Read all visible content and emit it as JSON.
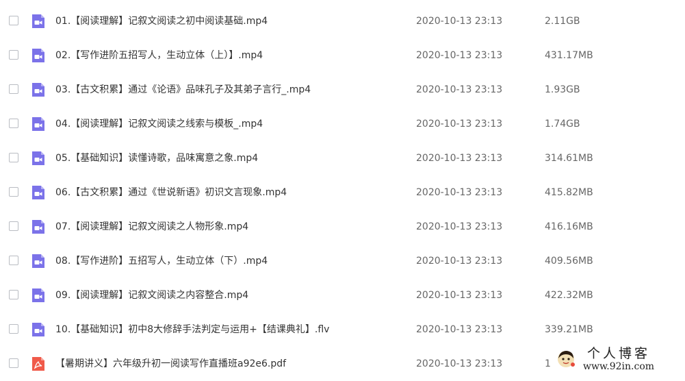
{
  "files": [
    {
      "name": "01.【阅读理解】记叙文阅读之初中阅读基础.mp4",
      "date": "2020-10-13 23:13",
      "size": "2.11GB",
      "type": "video"
    },
    {
      "name": "02.【写作进阶五招写人，生动立体（上）】.mp4",
      "date": "2020-10-13 23:13",
      "size": "431.17MB",
      "type": "video"
    },
    {
      "name": "03.【古文积累】通过《论语》品味孔子及其弟子言行_.mp4",
      "date": "2020-10-13 23:13",
      "size": "1.93GB",
      "type": "video"
    },
    {
      "name": "04.【阅读理解】记叙文阅读之线索与模板_.mp4",
      "date": "2020-10-13 23:13",
      "size": "1.74GB",
      "type": "video"
    },
    {
      "name": "05.【基础知识】读懂诗歌，品味寓意之象.mp4",
      "date": "2020-10-13 23:13",
      "size": "314.61MB",
      "type": "video"
    },
    {
      "name": "06.【古文积累】通过《世说新语》初识文言现象.mp4",
      "date": "2020-10-13 23:13",
      "size": "415.82MB",
      "type": "video"
    },
    {
      "name": "07.【阅读理解】记叙文阅读之人物形象.mp4",
      "date": "2020-10-13 23:13",
      "size": "416.16MB",
      "type": "video"
    },
    {
      "name": "08.【写作进阶】五招写人，生动立体（下）.mp4",
      "date": "2020-10-13 23:13",
      "size": "409.56MB",
      "type": "video"
    },
    {
      "name": "09.【阅读理解】记叙文阅读之内容整合.mp4",
      "date": "2020-10-13 23:13",
      "size": "422.32MB",
      "type": "video"
    },
    {
      "name": "10.【基础知识】初中8大修辞手法判定与运用+【结课典礼】.flv",
      "date": "2020-10-13 23:13",
      "size": "339.21MB",
      "type": "video"
    },
    {
      "name": "【暑期讲义】六年级升初一阅读写作直播班a92e6.pdf",
      "date": "2020-10-13 23:13",
      "size": "1",
      "type": "pdf"
    }
  ],
  "icons": {
    "video": "video-file-icon",
    "pdf": "pdf-file-icon"
  },
  "colors": {
    "video_icon": "#7b72e9",
    "pdf_icon": "#f05a4a",
    "checkbox_border": "#b9bcc2"
  },
  "watermark": {
    "title": "个人博客",
    "url": "www.92in.com"
  }
}
